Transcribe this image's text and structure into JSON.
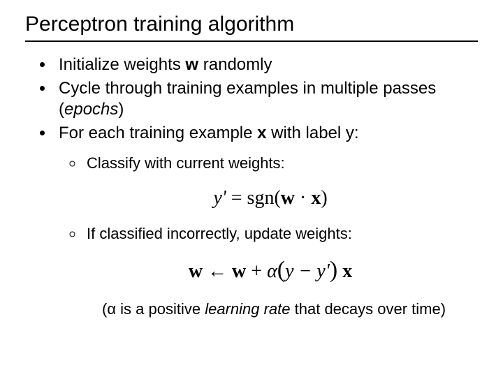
{
  "title": "Perceptron training algorithm",
  "bullets": {
    "b1a": "Initialize weights ",
    "b1b": "w",
    "b1c": " randomly",
    "b2a": "Cycle through training examples in multiple passes (",
    "b2b": "epochs",
    "b2c": ")",
    "b3a": "For each training example ",
    "b3b": "x",
    "b3c": " with label y:"
  },
  "sub": {
    "s1": "Classify with current weights:",
    "s2": "If classified incorrectly, update weights:"
  },
  "formula1": {
    "lhs": "y' ",
    "eq": "=",
    "sgn": " sgn(",
    "w": "w",
    "dot": " · ",
    "x": "x",
    "close": ")"
  },
  "formula2": {
    "w1": "w",
    "arrow": " ← ",
    "w2": "w",
    "plus": " + ",
    "alpha": "α",
    "lp": "(",
    "diff": "y − y'",
    "rp": ")",
    "sp": " ",
    "x": "x"
  },
  "note": {
    "a": "(α is a positive ",
    "b": "learning rate",
    "c": " that decays over time)"
  }
}
